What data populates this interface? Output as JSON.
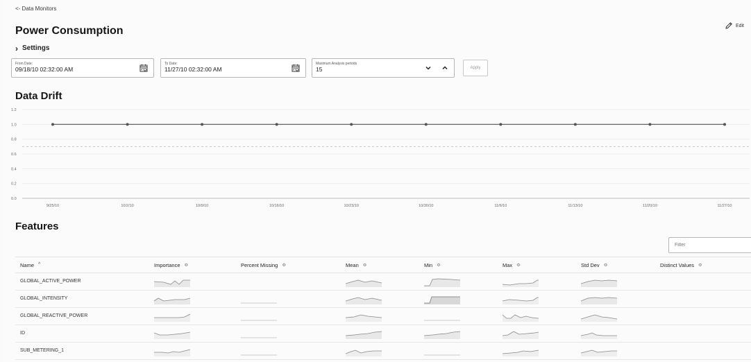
{
  "nav": {
    "back_label": "<- Data Monitors"
  },
  "page": {
    "title": "Power Consumption",
    "edit_label": "Edit"
  },
  "settings": {
    "label": "Settings",
    "from_date": {
      "label": "From Date:",
      "value": "09/18/10 02:32:00 AM"
    },
    "to_date": {
      "label": "To Date:",
      "value": "11/27/10 02:32:00 AM"
    },
    "max_periods": {
      "label": "Maximum Analysis periods",
      "value": "15"
    },
    "apply_label": "Apply"
  },
  "drift": {
    "title": "Data Drift",
    "chart_data": {
      "type": "line",
      "x": [
        "9/25/10",
        "10/2/10",
        "10/9/10",
        "10/16/10",
        "10/23/10",
        "10/30/10",
        "11/6/10",
        "11/13/10",
        "11/20/10",
        "11/27/10"
      ],
      "series": [
        {
          "values": [
            1.0,
            1.0,
            1.0,
            1.0,
            1.0,
            1.0,
            1.0,
            1.0,
            1.0,
            1.0
          ]
        }
      ],
      "threshold": 0.7,
      "ylim": [
        0,
        1.2
      ],
      "yticks": [
        "0.0",
        "0.2",
        "0.4",
        "0.6",
        "0.8",
        "1.0",
        "1.2"
      ],
      "grid": true,
      "colors": {
        "line": "#555555",
        "threshold": "#c8c8c8",
        "grid": "#ececec"
      }
    }
  },
  "features": {
    "title": "Features",
    "filter_placeholder": "Filter",
    "columns": [
      {
        "label": "Name",
        "sort": "^"
      },
      {
        "label": "Importance",
        "sort": "≎"
      },
      {
        "label": "Percent Missing",
        "sort": "≎"
      },
      {
        "label": "Mean",
        "sort": "≎"
      },
      {
        "label": "Min",
        "sort": "≎"
      },
      {
        "label": "Max",
        "sort": "≎"
      },
      {
        "label": "Std Dev",
        "sort": "≎"
      },
      {
        "label": "Distinct Values",
        "sort": "≎"
      }
    ],
    "rows": [
      {
        "name": "GLOBAL_ACTIVE_POWER"
      },
      {
        "name": "GLOBAL_INTENSITY"
      },
      {
        "name": "GLOBAL_REACTIVE_POWER"
      },
      {
        "name": "ID"
      },
      {
        "name": "SUB_METERING_1"
      }
    ]
  }
}
